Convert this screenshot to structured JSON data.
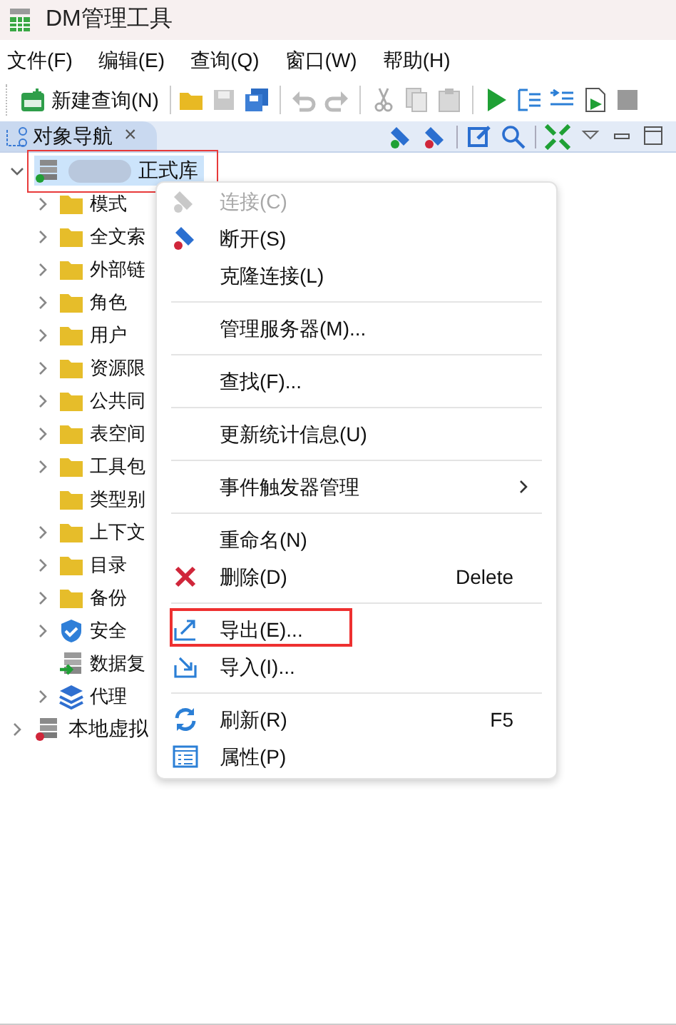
{
  "window": {
    "title": "DM管理工具"
  },
  "menu_bar": [
    "文件(F)",
    "编辑(E)",
    "查询(Q)",
    "窗口(W)",
    "帮助(H)"
  ],
  "toolbar": {
    "new_query": "新建查询(N)"
  },
  "panel": {
    "tab": {
      "label": "对象导航",
      "close": "×",
      "selected": true
    }
  },
  "tree": [
    {
      "label": "正式库",
      "kind": "database",
      "connected": true,
      "selected": true,
      "expanded": true,
      "highlighted": true,
      "children": [
        {
          "label": "模式",
          "kind": "folder",
          "expandable": true
        },
        {
          "label": "全文索",
          "kind": "folder",
          "expandable": true
        },
        {
          "label": "外部链",
          "kind": "folder",
          "expandable": true
        },
        {
          "label": "角色",
          "kind": "folder",
          "expandable": true
        },
        {
          "label": "用户",
          "kind": "folder",
          "expandable": true
        },
        {
          "label": "资源限",
          "kind": "folder",
          "expandable": true
        },
        {
          "label": "公共同",
          "kind": "folder",
          "expandable": true
        },
        {
          "label": "表空间",
          "kind": "folder",
          "expandable": true
        },
        {
          "label": "工具包",
          "kind": "folder",
          "expandable": true
        },
        {
          "label": "类型别",
          "kind": "folder",
          "expandable": false
        },
        {
          "label": "上下文",
          "kind": "folder",
          "expandable": true
        },
        {
          "label": "目录",
          "kind": "folder",
          "expandable": true
        },
        {
          "label": "备份",
          "kind": "folder",
          "expandable": true
        },
        {
          "label": "安全",
          "kind": "security",
          "expandable": true
        },
        {
          "label": "数据复",
          "kind": "replication",
          "expandable": false
        },
        {
          "label": "代理",
          "kind": "agent",
          "expandable": true
        }
      ]
    },
    {
      "label": "本地虚拟",
      "kind": "database",
      "connected": false,
      "selected": false,
      "expanded": false,
      "highlighted": false
    }
  ],
  "context_menu": [
    {
      "kind": "item",
      "label": "连接(C)",
      "disabled": true,
      "highlighted": false
    },
    {
      "kind": "item",
      "label": "断开(S)",
      "disabled": false,
      "highlighted": false
    },
    {
      "kind": "item",
      "label": "克隆连接(L)",
      "disabled": false,
      "highlighted": false
    },
    {
      "kind": "separator"
    },
    {
      "kind": "item",
      "label": "管理服务器(M)...",
      "disabled": false,
      "highlighted": false
    },
    {
      "kind": "separator"
    },
    {
      "kind": "item",
      "label": "查找(F)...",
      "disabled": false,
      "highlighted": false
    },
    {
      "kind": "separator"
    },
    {
      "kind": "item",
      "label": "更新统计信息(U)",
      "disabled": false,
      "highlighted": false
    },
    {
      "kind": "separator"
    },
    {
      "kind": "item",
      "label": "事件触发器管理",
      "submenu": true,
      "disabled": false,
      "highlighted": false
    },
    {
      "kind": "separator"
    },
    {
      "kind": "item",
      "label": "重命名(N)",
      "disabled": false,
      "highlighted": false
    },
    {
      "kind": "item",
      "label": "删除(D)",
      "shortcut": "Delete",
      "disabled": false,
      "highlighted": false
    },
    {
      "kind": "separator"
    },
    {
      "kind": "item",
      "label": "导出(E)...",
      "disabled": false,
      "highlighted": true
    },
    {
      "kind": "item",
      "label": "导入(I)...",
      "disabled": false,
      "highlighted": false
    },
    {
      "kind": "separator"
    },
    {
      "kind": "item",
      "label": "刷新(R)",
      "shortcut": "F5",
      "disabled": false,
      "highlighted": false
    },
    {
      "kind": "item",
      "label": "属性(P)",
      "disabled": false,
      "highlighted": false
    }
  ]
}
